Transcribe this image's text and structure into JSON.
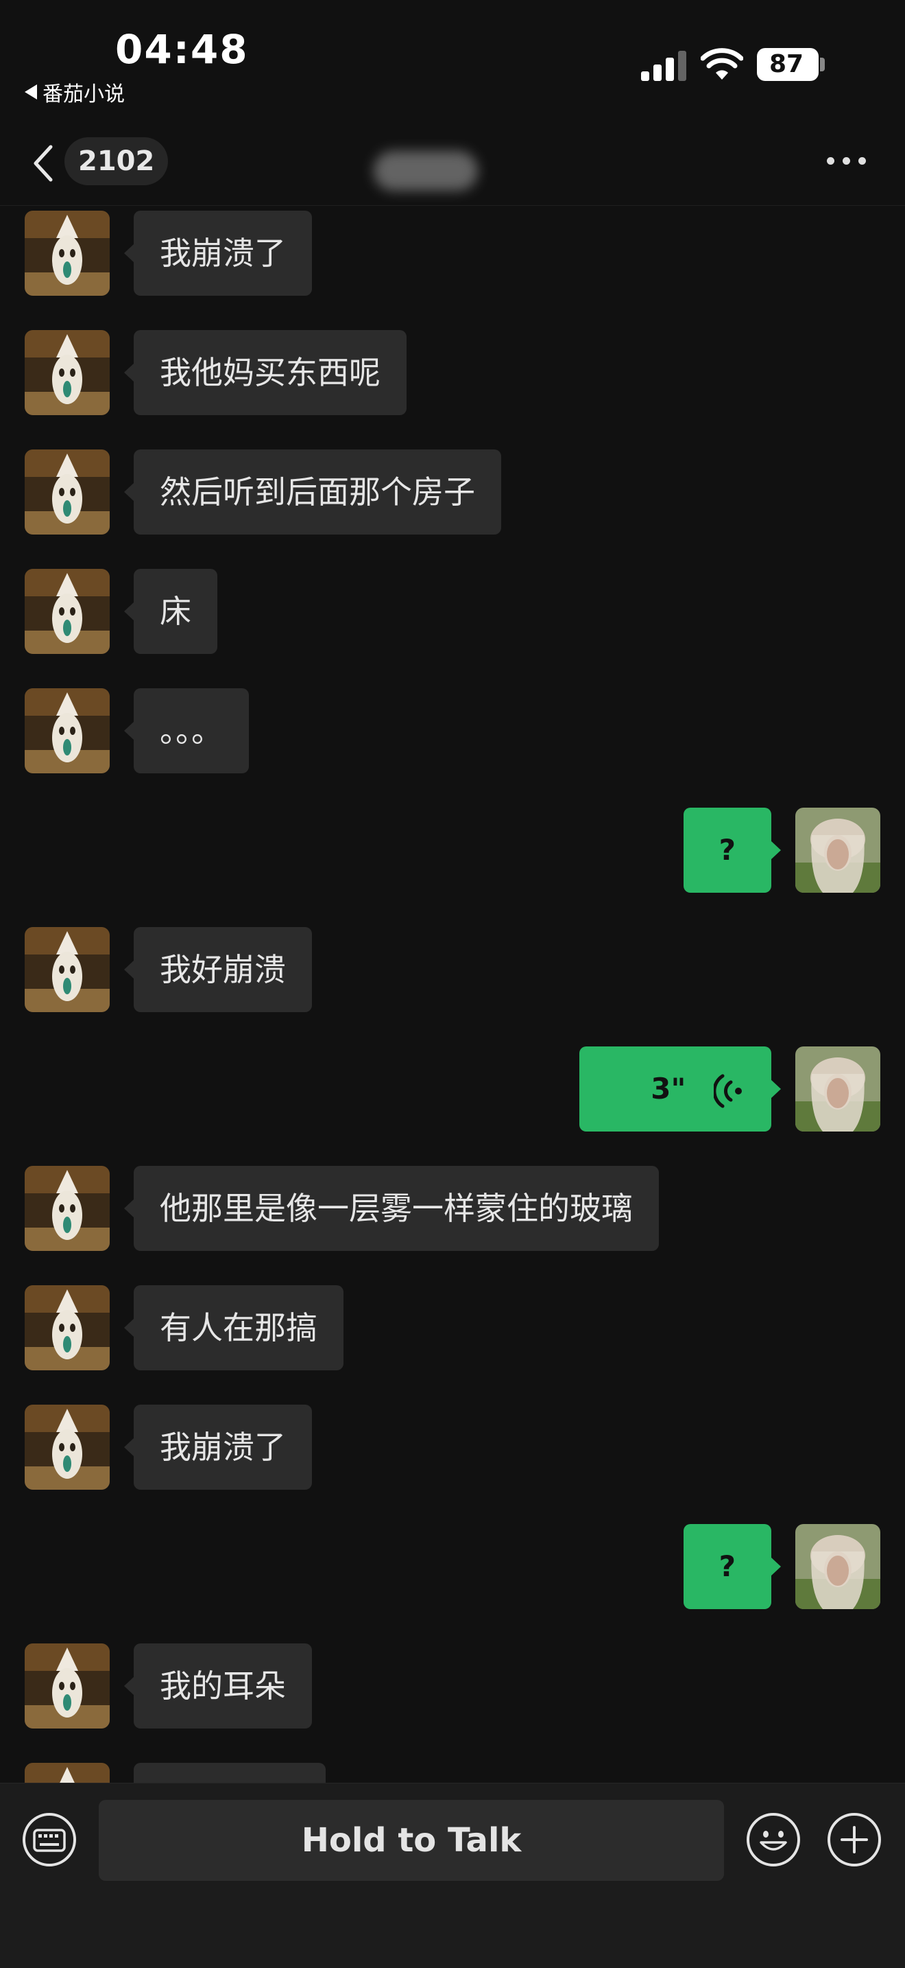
{
  "status_bar": {
    "time": "04:48",
    "back_app": "番茄小说",
    "battery": "87"
  },
  "nav": {
    "title_count": "2102",
    "back_icon": "chevron-left-icon",
    "more_icon": "ellipsis-icon"
  },
  "messages": [
    {
      "side": "left",
      "text": "我崩溃了"
    },
    {
      "side": "left",
      "text": "我他妈买东西呢"
    },
    {
      "side": "left",
      "text": "然后听到后面那个房子"
    },
    {
      "side": "left",
      "text": "床"
    },
    {
      "side": "left",
      "text": "。。。"
    },
    {
      "side": "right",
      "text": "?"
    },
    {
      "side": "left",
      "text": "我好崩溃"
    },
    {
      "side": "right",
      "type": "voice",
      "text": "3\""
    },
    {
      "side": "left",
      "text": "他那里是像一层雾一样蒙住的玻璃"
    },
    {
      "side": "left",
      "text": "有人在那搞"
    },
    {
      "side": "left",
      "text": "我崩溃了"
    },
    {
      "side": "right",
      "text": "?"
    },
    {
      "side": "left",
      "text": "我的耳朵"
    }
  ],
  "input_bar": {
    "hold_to_talk": "Hold to Talk",
    "keyboard_icon": "keyboard-icon",
    "emoji_icon": "emoji-icon",
    "plus_icon": "plus-icon"
  },
  "colors": {
    "background": "#111111",
    "bubble_in": "#2c2c2c",
    "bubble_out": "#29b764"
  }
}
